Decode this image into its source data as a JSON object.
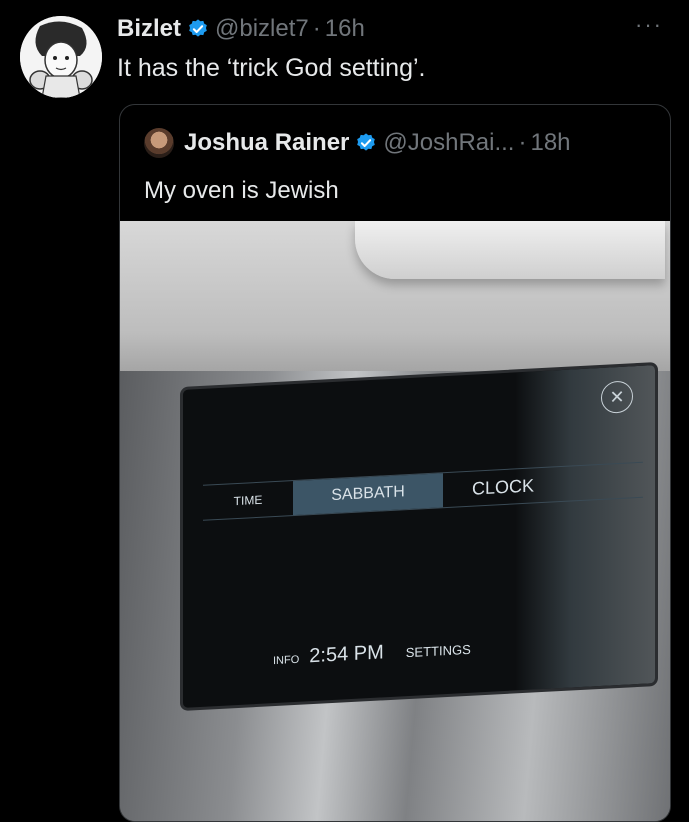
{
  "tweet": {
    "name": "Bizlet",
    "handle": "@bizlet7",
    "separator": "·",
    "time": "16h",
    "text": "It has the ‘trick God setting’.",
    "more": "···"
  },
  "quote": {
    "name": "Joshua Rainer",
    "handle": "@JoshRai...",
    "separator": "·",
    "time": "18h",
    "text": "My oven is Jewish"
  },
  "oven_display": {
    "tabs": [
      "TIME",
      "SABBATH",
      "CLOCK"
    ],
    "info": "INFO",
    "clock": "2:54 PM",
    "settings": "SETTINGS",
    "close": "✕"
  },
  "colors": {
    "background": "#000000",
    "verified": "#1d9bf0",
    "muted": "#71767b"
  }
}
